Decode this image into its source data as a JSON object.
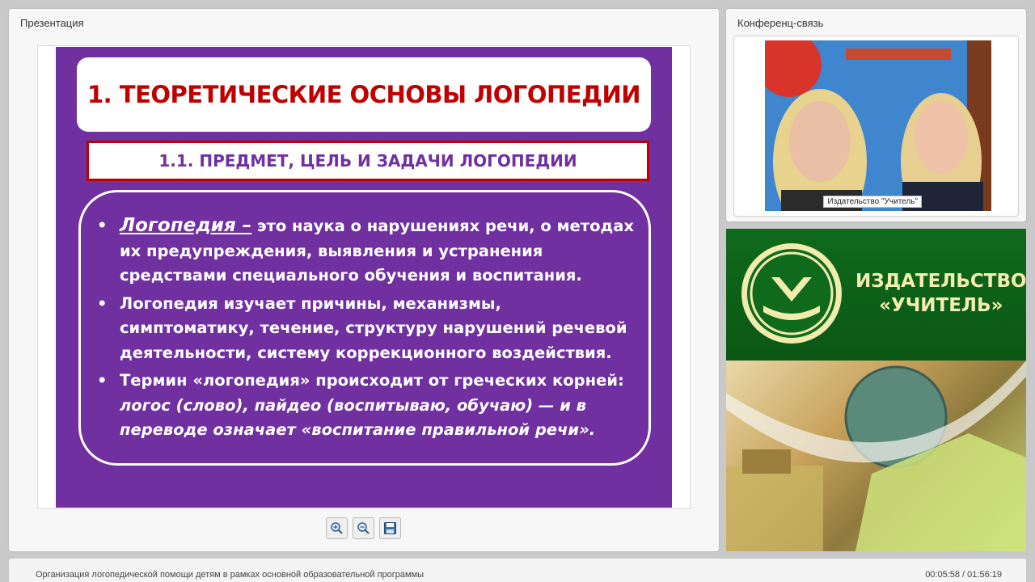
{
  "presentation_panel": {
    "title": "Презентация"
  },
  "slide": {
    "title": "1. ТЕОРЕТИЧЕСКИЕ ОСНОВЫ ЛОГОПЕДИИ",
    "subtitle": "1.1. ПРЕДМЕТ, ЦЕЛЬ И ЗАДАЧИ ЛОГОПЕДИИ",
    "bullets": [
      {
        "term": "Логопедия –",
        "text": " это наука о нарушениях речи, о методах их предупреждения, выявления и устранения средствами специального обучения и воспитания."
      },
      {
        "text": "Логопедия изучает причины, механизмы, симптоматику, течение, структуру нарушений речевой деятельности, систему коррекционного воздействия."
      },
      {
        "text": "Термин «логопедия» происходит от греческих корней: ",
        "italic": "логос (слово), пайдео (воспитываю, обучаю) — и в переводе означает «воспитание правильной речи»."
      }
    ],
    "bullet_char": "•"
  },
  "toolbar": {
    "zoom_in_icon": "zoom-in-icon",
    "zoom_out_icon": "zoom-out-icon",
    "save_icon": "save-icon"
  },
  "conference_panel": {
    "title": "Конференц-связь",
    "video_caption": "Издательство \"Учитель\""
  },
  "publisher": {
    "name_line1": "ИЗДАТЕЛЬСТВО",
    "name_line2": "«УЧИТЕЛЬ»"
  },
  "footer": {
    "title": "Организация логопедической помощи детям в рамках основной образовательной программы",
    "time": "00:05:58 / 01:56:19"
  },
  "colors": {
    "slide_bg": "#7030a0",
    "title_red": "#c00000",
    "publisher_green": "#0f6a1c"
  }
}
